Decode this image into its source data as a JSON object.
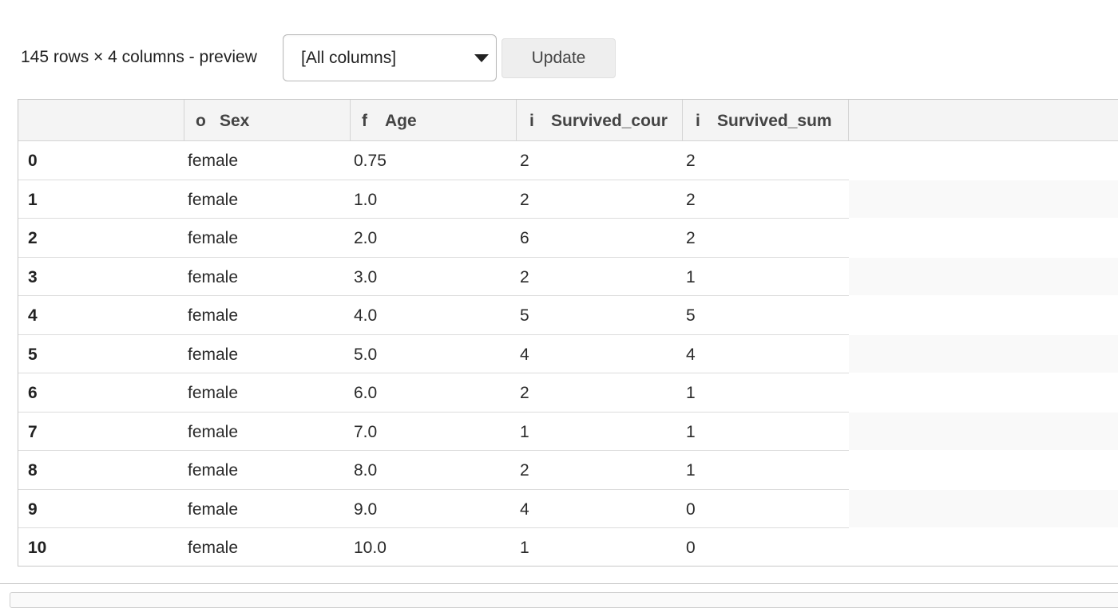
{
  "toolbar": {
    "summary": "145 rows × 4 columns - preview",
    "column_select_value": "[All columns]",
    "update_label": "Update"
  },
  "table": {
    "columns": [
      {
        "dtype": "",
        "name": ""
      },
      {
        "dtype": "o",
        "name": "Sex"
      },
      {
        "dtype": "f",
        "name": "Age"
      },
      {
        "dtype": "i",
        "name": "Survived_cour"
      },
      {
        "dtype": "i",
        "name": "Survived_sum"
      }
    ],
    "rows": [
      {
        "index": "0",
        "sex": "female",
        "age": "0.75",
        "survived_count": "2",
        "survived_sum": "2"
      },
      {
        "index": "1",
        "sex": "female",
        "age": "1.0",
        "survived_count": "2",
        "survived_sum": "2"
      },
      {
        "index": "2",
        "sex": "female",
        "age": "2.0",
        "survived_count": "6",
        "survived_sum": "2"
      },
      {
        "index": "3",
        "sex": "female",
        "age": "3.0",
        "survived_count": "2",
        "survived_sum": "1"
      },
      {
        "index": "4",
        "sex": "female",
        "age": "4.0",
        "survived_count": "5",
        "survived_sum": "5"
      },
      {
        "index": "5",
        "sex": "female",
        "age": "5.0",
        "survived_count": "4",
        "survived_sum": "4"
      },
      {
        "index": "6",
        "sex": "female",
        "age": "6.0",
        "survived_count": "2",
        "survived_sum": "1"
      },
      {
        "index": "7",
        "sex": "female",
        "age": "7.0",
        "survived_count": "1",
        "survived_sum": "1"
      },
      {
        "index": "8",
        "sex": "female",
        "age": "8.0",
        "survived_count": "2",
        "survived_sum": "1"
      },
      {
        "index": "9",
        "sex": "female",
        "age": "9.0",
        "survived_count": "4",
        "survived_sum": "0"
      },
      {
        "index": "10",
        "sex": "female",
        "age": "10.0",
        "survived_count": "1",
        "survived_sum": "0"
      }
    ]
  }
}
